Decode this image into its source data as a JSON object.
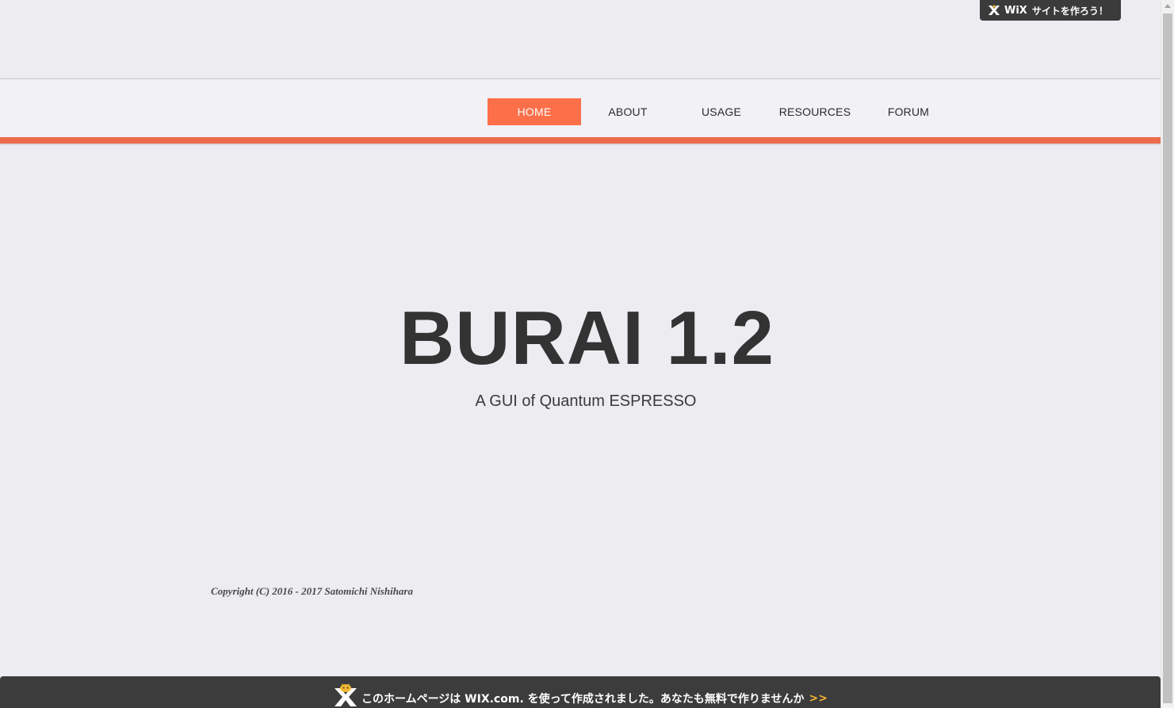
{
  "wix_badge": {
    "brand": "WiX",
    "cta": "サイトを作ろう！",
    "icon": "wix-x-icon"
  },
  "nav": {
    "items": [
      {
        "label": "HOME",
        "active": true
      },
      {
        "label": "ABOUT",
        "active": false
      },
      {
        "label": "USAGE",
        "active": false
      },
      {
        "label": "RESOURCES",
        "active": false
      },
      {
        "label": "FORUM",
        "active": false
      }
    ],
    "accent_color": "#ec6b4c",
    "active_color": "#fd6f49"
  },
  "hero": {
    "title": "BURAI 1.2",
    "subtitle": "A GUI of Quantum ESPRESSO"
  },
  "footer": {
    "copyright": "Copyright (C) 2016 - 2017 Satomichi Nishihara"
  },
  "bottom_banner": {
    "message": "このホームページは WIX.com. を使って作成されました。あなたも無料で作りませんか",
    "arrows": ">>",
    "icon": "wix-mascot-icon",
    "arrow_color": "#f5b731"
  }
}
